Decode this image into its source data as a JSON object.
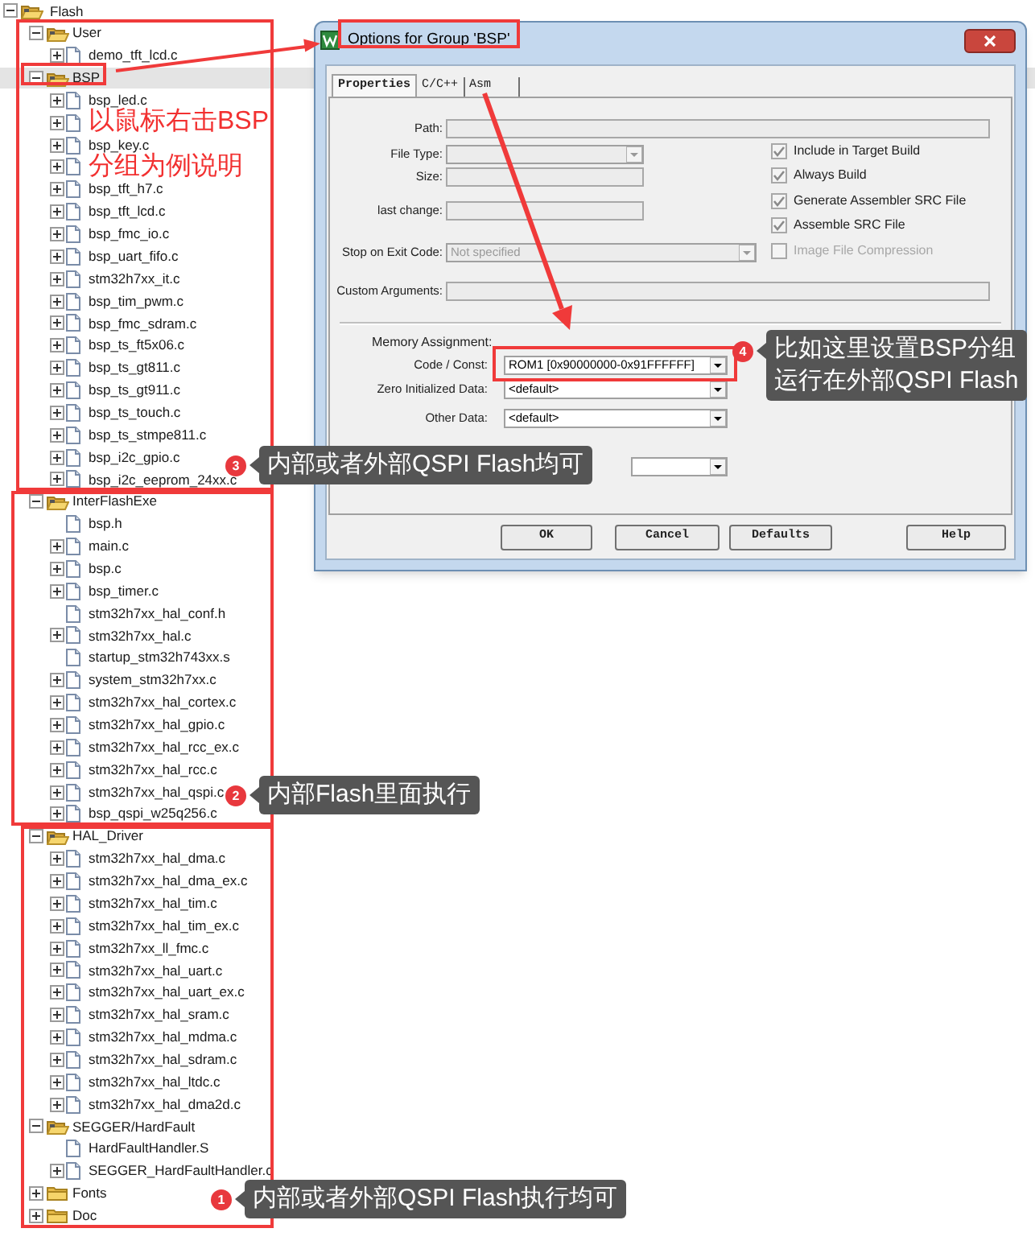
{
  "tree": {
    "label": "Flash",
    "expanded": true,
    "children": [
      {
        "label": "User",
        "expanded": true,
        "selected": false,
        "children": [
          {
            "label": "demo_tft_lcd.c",
            "expandable": true
          }
        ]
      },
      {
        "label": "BSP",
        "expanded": true,
        "selected": true,
        "children": [
          {
            "label": "bsp_led.c",
            "expandable": true
          },
          {
            "expandable": true
          },
          {
            "label": "bsp_key.c",
            "expandable": true
          },
          {
            "expandable": true
          },
          {
            "label": "bsp_tft_h7.c",
            "expandable": true
          },
          {
            "label": "bsp_tft_lcd.c",
            "expandable": true
          },
          {
            "label": "bsp_fmc_io.c",
            "expandable": true
          },
          {
            "label": "bsp_uart_fifo.c",
            "expandable": true
          },
          {
            "label": "stm32h7xx_it.c",
            "expandable": true
          },
          {
            "label": "bsp_tim_pwm.c",
            "expandable": true
          },
          {
            "label": "bsp_fmc_sdram.c",
            "expandable": true
          },
          {
            "label": "bsp_ts_ft5x06.c",
            "expandable": true
          },
          {
            "label": "bsp_ts_gt811.c",
            "expandable": true
          },
          {
            "label": "bsp_ts_gt911.c",
            "expandable": true
          },
          {
            "label": "bsp_ts_touch.c",
            "expandable": true
          },
          {
            "label": "bsp_ts_stmpe811.c",
            "expandable": true
          },
          {
            "label": "bsp_i2c_gpio.c",
            "expandable": true
          },
          {
            "label": "bsp_i2c_eeprom_24xx.c",
            "expandable": true
          }
        ]
      },
      {
        "label": "InterFlashExe",
        "expanded": true,
        "selected": false,
        "children": [
          {
            "label": "bsp.h",
            "expandable": false
          },
          {
            "label": "main.c",
            "expandable": true
          },
          {
            "label": "bsp.c",
            "expandable": true
          },
          {
            "label": "bsp_timer.c",
            "expandable": true
          },
          {
            "label": "stm32h7xx_hal_conf.h",
            "expandable": false
          },
          {
            "label": "stm32h7xx_hal.c",
            "expandable": true
          },
          {
            "label": "startup_stm32h743xx.s",
            "expandable": false
          },
          {
            "label": "system_stm32h7xx.c",
            "expandable": true
          },
          {
            "label": "stm32h7xx_hal_cortex.c",
            "expandable": true
          },
          {
            "label": "stm32h7xx_hal_gpio.c",
            "expandable": true
          },
          {
            "label": "stm32h7xx_hal_rcc_ex.c",
            "expandable": true
          },
          {
            "label": "stm32h7xx_hal_rcc.c",
            "expandable": true
          },
          {
            "label": "stm32h7xx_hal_qspi.c",
            "expandable": true
          },
          {
            "label": "bsp_qspi_w25q256.c",
            "expandable": true
          }
        ]
      },
      {
        "label": "HAL_Driver",
        "expanded": true,
        "selected": false,
        "children": [
          {
            "label": "stm32h7xx_hal_dma.c",
            "expandable": true
          },
          {
            "label": "stm32h7xx_hal_dma_ex.c",
            "expandable": true
          },
          {
            "label": "stm32h7xx_hal_tim.c",
            "expandable": true
          },
          {
            "label": "stm32h7xx_hal_tim_ex.c",
            "expandable": true
          },
          {
            "label": "stm32h7xx_ll_fmc.c",
            "expandable": true
          },
          {
            "label": "stm32h7xx_hal_uart.c",
            "expandable": true
          },
          {
            "label": "stm32h7xx_hal_uart_ex.c",
            "expandable": true
          },
          {
            "label": "stm32h7xx_hal_sram.c",
            "expandable": true
          },
          {
            "label": "stm32h7xx_hal_mdma.c",
            "expandable": true
          },
          {
            "label": "stm32h7xx_hal_sdram.c",
            "expandable": true
          },
          {
            "label": "stm32h7xx_hal_ltdc.c",
            "expandable": true
          },
          {
            "label": "stm32h7xx_hal_dma2d.c",
            "expandable": true
          }
        ]
      },
      {
        "label": "SEGGER/HardFault",
        "expanded": true,
        "selected": false,
        "children": [
          {
            "label": "HardFaultHandler.S",
            "expandable": false
          },
          {
            "label": "SEGGER_HardFaultHandler.c",
            "expandable": true
          }
        ]
      },
      {
        "label": "Fonts",
        "expanded": false,
        "selected": false
      },
      {
        "label": "Doc",
        "expanded": false,
        "selected": false
      }
    ]
  },
  "dialog": {
    "title": "Options for Group 'BSP'",
    "tabs": [
      {
        "label": "Properties",
        "selected": true
      },
      {
        "label": "C/C++",
        "selected": false
      },
      {
        "label": "Asm",
        "selected": false
      }
    ],
    "path": {
      "label": "Path:"
    },
    "file_type": {
      "label": "File Type:"
    },
    "size": {
      "label": "Size:"
    },
    "last_change": {
      "label": "last change:"
    },
    "stop_on_exit_code": {
      "label": "Stop on Exit Code:",
      "value": "Not specified"
    },
    "custom_arguments": {
      "label": "Custom Arguments:"
    },
    "options": [
      {
        "label": "Include in Target Build",
        "checked": true,
        "disabled": false
      },
      {
        "label": "Always Build",
        "checked": true,
        "disabled": false
      },
      {
        "label": "Generate Assembler SRC File",
        "checked": true,
        "disabled": false
      },
      {
        "label": "Assemble SRC File",
        "checked": true,
        "disabled": false
      },
      {
        "label": "Image File Compression",
        "checked": false,
        "disabled": true
      }
    ],
    "memory_assignment": {
      "label": "Memory Assignment:",
      "rows": [
        {
          "label": "Code / Const:",
          "value": "ROM1 [0x90000000-0x91FFFFFF]"
        },
        {
          "label": "Zero Initialized Data:",
          "value": "<default>"
        },
        {
          "label": "Other Data:",
          "value": "<default>"
        }
      ]
    },
    "buttons": [
      "OK",
      "Cancel",
      "Defaults",
      "Help"
    ]
  },
  "annotation_text": [
    "以鼠标右击BSP",
    "分组为例说明"
  ],
  "callouts": [
    {
      "number": "4",
      "lines": [
        "比如这里设置BSP分组",
        "运行在外部QSPI Flash"
      ]
    },
    {
      "number": "3",
      "lines": [
        "内部或者外部QSPI Flash均可"
      ]
    },
    {
      "number": "2",
      "lines": [
        "内部Flash里面执行"
      ]
    },
    {
      "number": "1",
      "lines": [
        "内部或者外部QSPI Flash执行均可"
      ]
    }
  ]
}
